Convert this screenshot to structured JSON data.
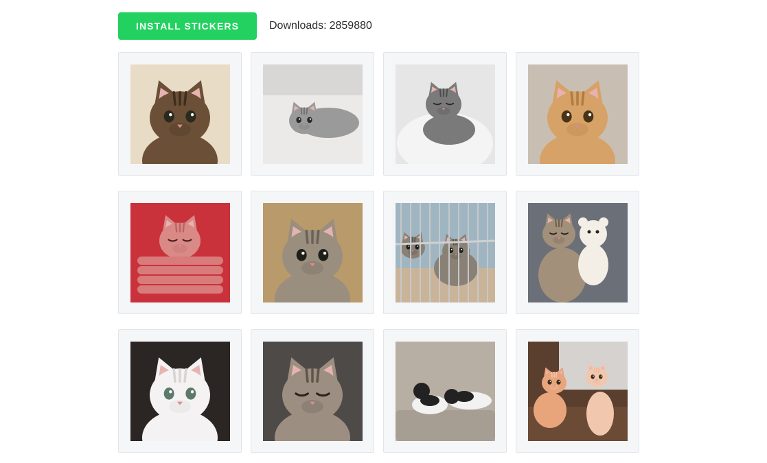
{
  "header": {
    "install_label": "INSTALL STICKERS",
    "downloads_label": "Downloads:",
    "downloads_count": "2859880"
  },
  "colors": {
    "accent": "#23d160",
    "card_bg": "#f5f6f8",
    "card_border": "#e2e4e8"
  },
  "stickers": [
    {
      "name": "sticker-kitten-tabby-window",
      "bg": "#e9dcc6",
      "fur": "#6b4f36",
      "fur2": "#3f2e1f",
      "eye": "#2a2a1e",
      "pose": "face"
    },
    {
      "name": "sticker-kitten-lying-bed",
      "bg": "#d9d7d6",
      "fur": "#9a9a9a",
      "fur2": "#6f6f6f",
      "eye": "#2a2a2a",
      "pose": "lying"
    },
    {
      "name": "sticker-kitten-sleeping-blanket",
      "bg": "#e6e6e6",
      "fur": "#7a7a7a",
      "fur2": "#4d4d4d",
      "eye": "#2a2a2a",
      "pose": "sleep"
    },
    {
      "name": "sticker-orange-cat-grin",
      "bg": "#c8bfb2",
      "fur": "#d7a267",
      "fur2": "#b07c43",
      "eye": "#4a3418",
      "pose": "face"
    },
    {
      "name": "sticker-kitten-in-hands-red",
      "bg": "#c9323b",
      "fur": "#d98a86",
      "fur2": "#b86462",
      "eye": "#4a1f1f",
      "pose": "hands"
    },
    {
      "name": "sticker-kitten-tabby-looking",
      "bg": "#b99a6b",
      "fur": "#9a8e7f",
      "fur2": "#6b6155",
      "eye": "#1f1f1a",
      "pose": "face"
    },
    {
      "name": "sticker-kittens-in-cage",
      "bg": "#9fb6c2",
      "fur": "#8a8176",
      "fur2": "#4f4a44",
      "eye": "#1f1f1f",
      "pose": "cage"
    },
    {
      "name": "sticker-kitten-hugging-teddy",
      "bg": "#6a6f78",
      "fur": "#a2907b",
      "fur2": "#6d5d4c",
      "eye": "#1f1f1f",
      "pose": "teddy"
    },
    {
      "name": "sticker-white-kitten-face",
      "bg": "#2b2624",
      "fur": "#f4f2f2",
      "fur2": "#d9d4d4",
      "eye": "#5c7a6a",
      "pose": "face"
    },
    {
      "name": "sticker-kitten-sleepy-squint",
      "bg": "#4d4a48",
      "fur": "#9c8f82",
      "fur2": "#5f554b",
      "eye": "#2a241e",
      "pose": "squint"
    },
    {
      "name": "sticker-kittens-on-sofa",
      "bg": "#b8afa4",
      "fur": "#f2f2f2",
      "fur2": "#222222",
      "eye": "#1f1f1f",
      "pose": "sofa"
    },
    {
      "name": "sticker-two-ginger-kittens",
      "bg": "#5a3f2e",
      "fur": "#e8a57b",
      "fur2": "#f1c7ae",
      "eye": "#3a2a1e",
      "pose": "pair"
    }
  ]
}
